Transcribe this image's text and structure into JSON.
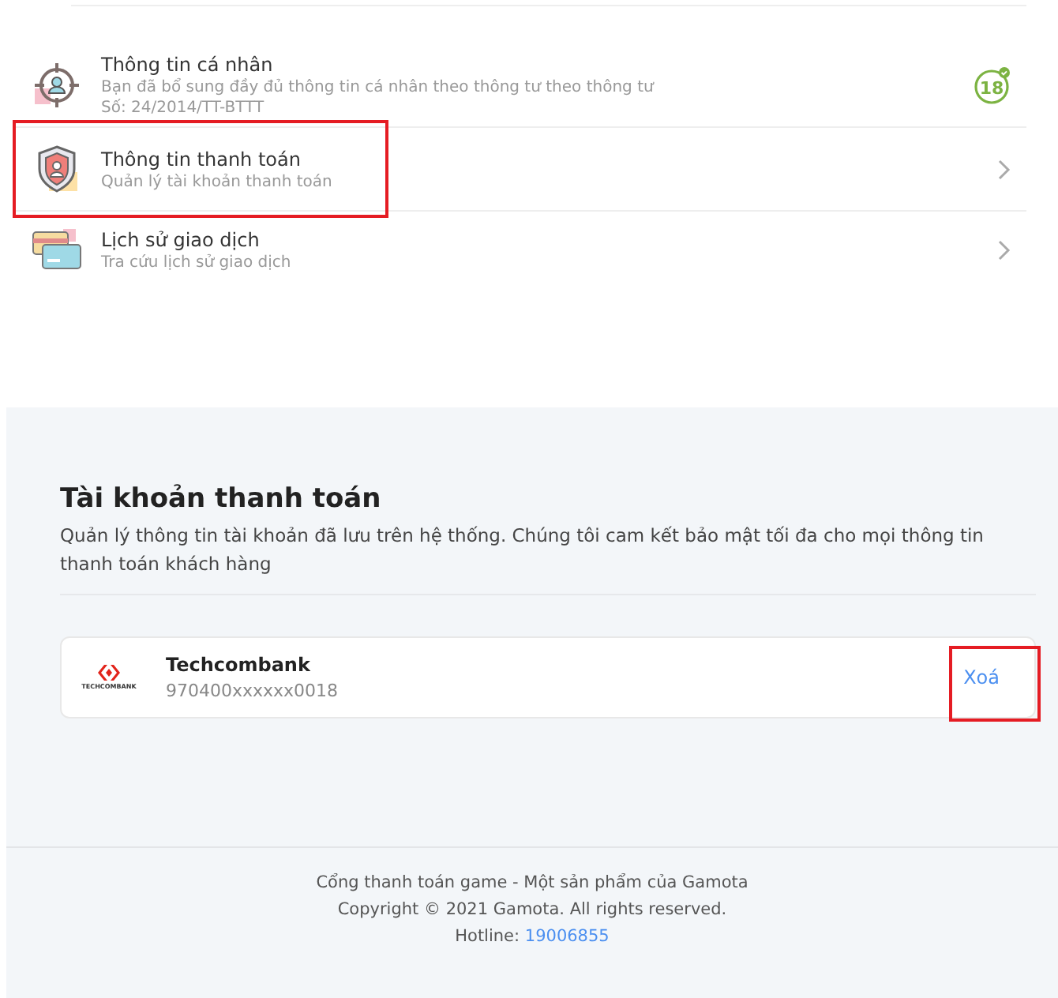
{
  "menu": [
    {
      "kind": "personal",
      "title": "Thông tin cá nhân",
      "subtitle": "Bạn đã bổ sung đầy đủ thông tin cá nhân theo thông tư theo thông tư",
      "note": "Số: 24/2014/TT-BTTT",
      "badge": "18",
      "highlighted": false
    },
    {
      "kind": "payment",
      "title": "Thông tin thanh toán",
      "subtitle": "Quản lý tài khoản thanh toán",
      "highlighted": true
    },
    {
      "kind": "history",
      "title": "Lịch sử giao dịch",
      "subtitle": "Tra cứu lịch sử giao dịch",
      "highlighted": false
    }
  ],
  "section": {
    "title": "Tài khoản thanh toán",
    "description": "Quản lý thông tin tài khoản đã lưu trên hệ thống. Chúng tôi cam kết bảo mật tối đa cho mọi thông tin thanh toán khách hàng"
  },
  "accounts": [
    {
      "logo_text": "TECHCOMBANK",
      "bank": "Techcombank",
      "number": "970400xxxxxx0018",
      "action": "Xoá",
      "action_highlighted": true
    }
  ],
  "footer": {
    "lines": [
      "Cổng thanh toán game - Một sản phẩm của Gamota",
      "Copyright © 2021 Gamota. All rights reserved."
    ],
    "hotline_label": "Hotline:",
    "hotline": "19006855"
  }
}
